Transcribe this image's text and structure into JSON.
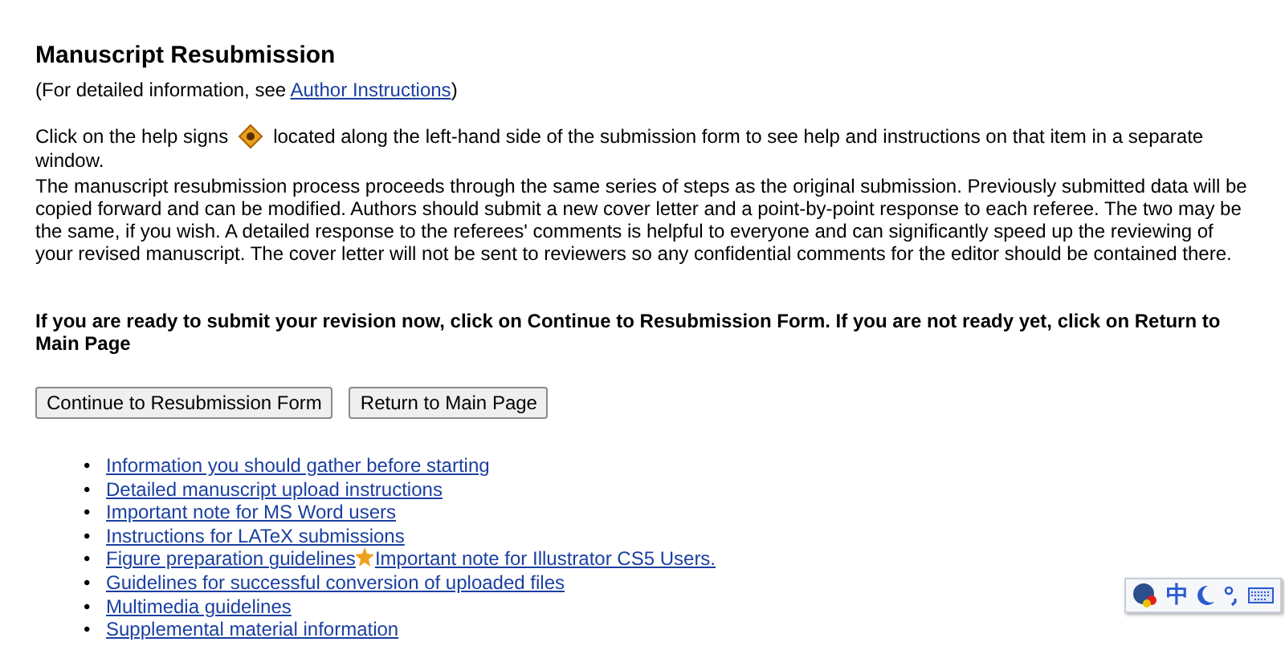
{
  "title": "Manuscript Resubmission",
  "info": {
    "before": "(For detailed information, see ",
    "link": "Author Instructions",
    "after": ")"
  },
  "help": {
    "before": "Click on the help signs",
    "after": "located along the left-hand side of the submission form to see help and instructions on that item in a separate",
    "wrap": "window."
  },
  "paragraph": "The manuscript resubmission process proceeds through the same series of steps as the original submission. Previously submitted data will be copied forward and can be modified. Authors should submit a new cover letter and a point-by-point response to each referee. The two may be the same, if you wish. A detailed response to the referees' comments is helpful to everyone and can significantly speed up the reviewing of your revised manuscript. The cover letter will not be sent to reviewers so any confidential comments for the editor should be contained there.",
  "prompt": "If you are ready to submit your revision now, click on Continue to Resubmission Form. If you are not ready yet, click on Return to Main Page",
  "buttons": [
    "Continue to Resubmission Form",
    "Return to Main Page"
  ],
  "links": [
    {
      "marker": "•",
      "label": "Information you should gather before starting"
    },
    {
      "marker": "•",
      "label": "Detailed manuscript upload instructions"
    },
    {
      "marker": "•",
      "label": "Important note for MS Word users"
    },
    {
      "marker": "•",
      "label": "Instructions for LATeX submissions"
    },
    {
      "marker": "•",
      "label": "Figure preparation guidelines",
      "extra": "Important note for Illustrator CS5 Users."
    },
    {
      "marker": "•",
      "label": "Guidelines for successful conversion of uploaded files"
    },
    {
      "marker": "•",
      "label": "Multimedia guidelines"
    },
    {
      "marker": "•",
      "label": "Supplemental material information"
    }
  ],
  "ime_bar": {
    "mode": "中"
  }
}
